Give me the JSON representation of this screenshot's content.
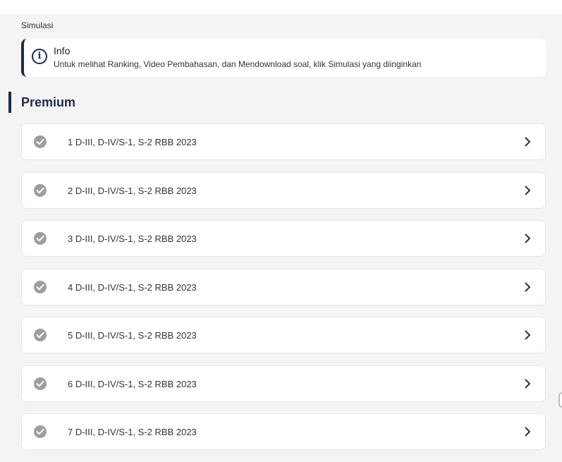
{
  "breadcrumb": "Simulasi",
  "info": {
    "title": "Info",
    "text": "Untuk melihat Ranking, Video Pembahasan, dan Mendownload soal, klik Simulasi yang diinginkan",
    "icon": "info-icon"
  },
  "section": {
    "title": "Premium"
  },
  "items": [
    {
      "label": "1 D-III, D-IV/S-1, S-2 RBB 2023",
      "status": "completed"
    },
    {
      "label": "2 D-III, D-IV/S-1, S-2 RBB 2023",
      "status": "completed"
    },
    {
      "label": "3 D-III, D-IV/S-1, S-2 RBB 2023",
      "status": "completed"
    },
    {
      "label": "4 D-III, D-IV/S-1, S-2 RBB 2023",
      "status": "completed"
    },
    {
      "label": "5 D-III, D-IV/S-1, S-2 RBB 2023",
      "status": "completed"
    },
    {
      "label": "6 D-III, D-IV/S-1, S-2 RBB 2023",
      "status": "completed"
    },
    {
      "label": "7 D-III, D-IV/S-1, S-2 RBB 2023",
      "status": "completed"
    }
  ],
  "colors": {
    "accent": "#1f2a4d",
    "check": "#9e9e9e",
    "background": "#f4f4f4"
  }
}
